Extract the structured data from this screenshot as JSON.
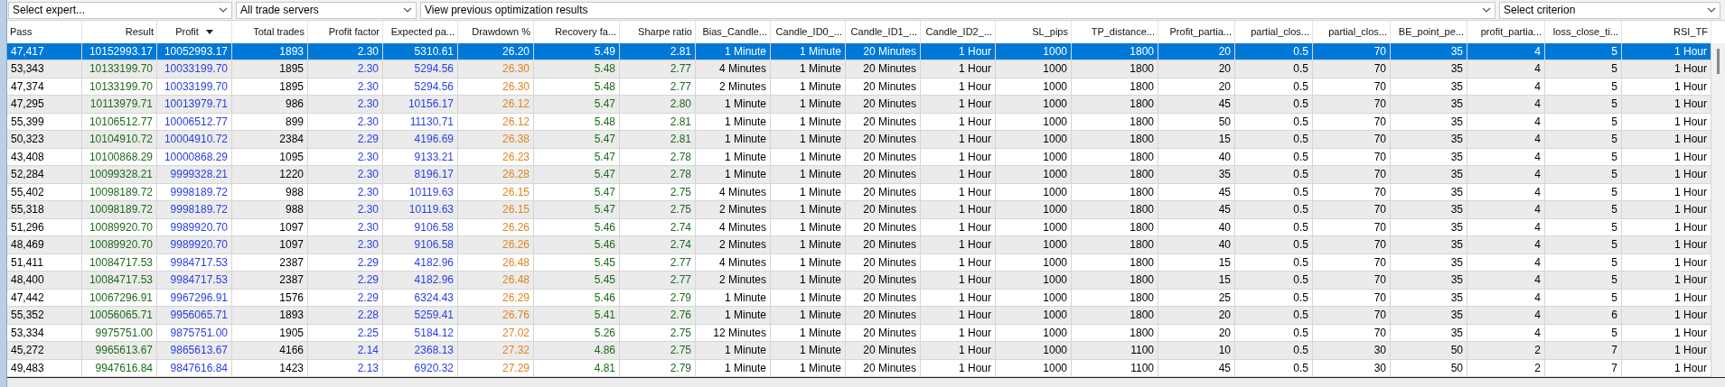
{
  "filters": [
    {
      "value": "Select expert..."
    },
    {
      "value": "All trade servers"
    },
    {
      "value": "View previous optimization results"
    },
    {
      "value": "Select criterion"
    }
  ],
  "table": {
    "columns": [
      {
        "label": "Pass",
        "color": "#000000",
        "sorted": false
      },
      {
        "label": "Result",
        "color": "#1b6b1b",
        "sorted": false
      },
      {
        "label": "Profit",
        "color": "#2a3fe0",
        "sorted": true
      },
      {
        "label": "Total trades",
        "color": "#000000",
        "sorted": false
      },
      {
        "label": "Profit factor",
        "color": "#2a3fe0",
        "sorted": false
      },
      {
        "label": "Expected pa...",
        "color": "#2a3fe0",
        "sorted": false
      },
      {
        "label": "Drawdown %",
        "color": "#e0841c",
        "sorted": false
      },
      {
        "label": "Recovery fa...",
        "color": "#1b6b1b",
        "sorted": false
      },
      {
        "label": "Sharpe ratio",
        "color": "#1b6b1b",
        "sorted": false
      },
      {
        "label": "Bias_Candle...",
        "color": "#000000",
        "sorted": false
      },
      {
        "label": "Candle_ID0_...",
        "color": "#000000",
        "sorted": false
      },
      {
        "label": "Candle_ID1_...",
        "color": "#000000",
        "sorted": false
      },
      {
        "label": "Candle_ID2_...",
        "color": "#000000",
        "sorted": false
      },
      {
        "label": "SL_pips",
        "color": "#000000",
        "sorted": false
      },
      {
        "label": "TP_distance...",
        "color": "#000000",
        "sorted": false
      },
      {
        "label": "Profit_partia...",
        "color": "#000000",
        "sorted": false
      },
      {
        "label": "partial_clos...",
        "color": "#000000",
        "sorted": false
      },
      {
        "label": "partial_clos...",
        "color": "#000000",
        "sorted": false
      },
      {
        "label": "BE_point_pe...",
        "color": "#000000",
        "sorted": false
      },
      {
        "label": "profit_partia...",
        "color": "#000000",
        "sorted": false
      },
      {
        "label": "loss_close_ti...",
        "color": "#000000",
        "sorted": false
      },
      {
        "label": "RSI_TF",
        "color": "#000000",
        "sorted": false
      }
    ],
    "rows": [
      {
        "selected": true,
        "cells": [
          "47,417",
          "10152993.17",
          "10052993.17",
          "1893",
          "2.30",
          "5310.61",
          "26.20",
          "5.49",
          "2.81",
          "1 Minute",
          "1 Minute",
          "20 Minutes",
          "1 Hour",
          "1000",
          "1800",
          "20",
          "0.5",
          "70",
          "35",
          "4",
          "5",
          "1 Hour"
        ]
      },
      {
        "selected": false,
        "cells": [
          "53,343",
          "10133199.70",
          "10033199.70",
          "1895",
          "2.30",
          "5294.56",
          "26.30",
          "5.48",
          "2.77",
          "4 Minutes",
          "1 Minute",
          "20 Minutes",
          "1 Hour",
          "1000",
          "1800",
          "20",
          "0.5",
          "70",
          "35",
          "4",
          "5",
          "1 Hour"
        ]
      },
      {
        "selected": false,
        "cells": [
          "47,374",
          "10133199.70",
          "10033199.70",
          "1895",
          "2.30",
          "5294.56",
          "26.30",
          "5.48",
          "2.77",
          "2 Minutes",
          "1 Minute",
          "20 Minutes",
          "1 Hour",
          "1000",
          "1800",
          "20",
          "0.5",
          "70",
          "35",
          "4",
          "5",
          "1 Hour"
        ]
      },
      {
        "selected": false,
        "cells": [
          "47,295",
          "10113979.71",
          "10013979.71",
          "986",
          "2.30",
          "10156.17",
          "26.12",
          "5.47",
          "2.80",
          "1 Minute",
          "1 Minute",
          "20 Minutes",
          "1 Hour",
          "1000",
          "1800",
          "45",
          "0.5",
          "70",
          "35",
          "4",
          "5",
          "1 Hour"
        ]
      },
      {
        "selected": false,
        "cells": [
          "55,399",
          "10106512.77",
          "10006512.77",
          "899",
          "2.30",
          "11130.71",
          "26.12",
          "5.48",
          "2.81",
          "1 Minute",
          "1 Minute",
          "20 Minutes",
          "1 Hour",
          "1000",
          "1800",
          "50",
          "0.5",
          "70",
          "35",
          "4",
          "5",
          "1 Hour"
        ]
      },
      {
        "selected": false,
        "cells": [
          "50,323",
          "10104910.72",
          "10004910.72",
          "2384",
          "2.29",
          "4196.69",
          "26.38",
          "5.47",
          "2.81",
          "1 Minute",
          "1 Minute",
          "20 Minutes",
          "1 Hour",
          "1000",
          "1800",
          "15",
          "0.5",
          "70",
          "35",
          "4",
          "5",
          "1 Hour"
        ]
      },
      {
        "selected": false,
        "cells": [
          "43,408",
          "10100868.29",
          "10000868.29",
          "1095",
          "2.30",
          "9133.21",
          "26.23",
          "5.47",
          "2.78",
          "1 Minute",
          "1 Minute",
          "20 Minutes",
          "1 Hour",
          "1000",
          "1800",
          "40",
          "0.5",
          "70",
          "35",
          "4",
          "5",
          "1 Hour"
        ]
      },
      {
        "selected": false,
        "cells": [
          "52,284",
          "10099328.21",
          "9999328.21",
          "1220",
          "2.30",
          "8196.17",
          "26.28",
          "5.47",
          "2.78",
          "1 Minute",
          "1 Minute",
          "20 Minutes",
          "1 Hour",
          "1000",
          "1800",
          "35",
          "0.5",
          "70",
          "35",
          "4",
          "5",
          "1 Hour"
        ]
      },
      {
        "selected": false,
        "cells": [
          "55,402",
          "10098189.72",
          "9998189.72",
          "988",
          "2.30",
          "10119.63",
          "26.15",
          "5.47",
          "2.75",
          "4 Minutes",
          "1 Minute",
          "20 Minutes",
          "1 Hour",
          "1000",
          "1800",
          "45",
          "0.5",
          "70",
          "35",
          "4",
          "5",
          "1 Hour"
        ]
      },
      {
        "selected": false,
        "cells": [
          "55,318",
          "10098189.72",
          "9998189.72",
          "988",
          "2.30",
          "10119.63",
          "26.15",
          "5.47",
          "2.75",
          "2 Minutes",
          "1 Minute",
          "20 Minutes",
          "1 Hour",
          "1000",
          "1800",
          "45",
          "0.5",
          "70",
          "35",
          "4",
          "5",
          "1 Hour"
        ]
      },
      {
        "selected": false,
        "cells": [
          "51,296",
          "10089920.70",
          "9989920.70",
          "1097",
          "2.30",
          "9106.58",
          "26.26",
          "5.46",
          "2.74",
          "4 Minutes",
          "1 Minute",
          "20 Minutes",
          "1 Hour",
          "1000",
          "1800",
          "40",
          "0.5",
          "70",
          "35",
          "4",
          "5",
          "1 Hour"
        ]
      },
      {
        "selected": false,
        "cells": [
          "48,469",
          "10089920.70",
          "9989920.70",
          "1097",
          "2.30",
          "9106.58",
          "26.26",
          "5.46",
          "2.74",
          "2 Minutes",
          "1 Minute",
          "20 Minutes",
          "1 Hour",
          "1000",
          "1800",
          "40",
          "0.5",
          "70",
          "35",
          "4",
          "5",
          "1 Hour"
        ]
      },
      {
        "selected": false,
        "cells": [
          "51,411",
          "10084717.53",
          "9984717.53",
          "2387",
          "2.29",
          "4182.96",
          "26.48",
          "5.45",
          "2.77",
          "4 Minutes",
          "1 Minute",
          "20 Minutes",
          "1 Hour",
          "1000",
          "1800",
          "15",
          "0.5",
          "70",
          "35",
          "4",
          "5",
          "1 Hour"
        ]
      },
      {
        "selected": false,
        "cells": [
          "48,400",
          "10084717.53",
          "9984717.53",
          "2387",
          "2.29",
          "4182.96",
          "26.48",
          "5.45",
          "2.77",
          "2 Minutes",
          "1 Minute",
          "20 Minutes",
          "1 Hour",
          "1000",
          "1800",
          "15",
          "0.5",
          "70",
          "35",
          "4",
          "5",
          "1 Hour"
        ]
      },
      {
        "selected": false,
        "cells": [
          "47,442",
          "10067296.91",
          "9967296.91",
          "1576",
          "2.29",
          "6324.43",
          "26.29",
          "5.46",
          "2.79",
          "1 Minute",
          "1 Minute",
          "20 Minutes",
          "1 Hour",
          "1000",
          "1800",
          "25",
          "0.5",
          "70",
          "35",
          "4",
          "5",
          "1 Hour"
        ]
      },
      {
        "selected": false,
        "cells": [
          "55,352",
          "10056065.71",
          "9956065.71",
          "1893",
          "2.28",
          "5259.41",
          "26.76",
          "5.41",
          "2.76",
          "1 Minute",
          "1 Minute",
          "20 Minutes",
          "1 Hour",
          "1000",
          "1800",
          "20",
          "0.5",
          "70",
          "35",
          "4",
          "6",
          "1 Hour"
        ]
      },
      {
        "selected": false,
        "cells": [
          "53,334",
          "9975751.00",
          "9875751.00",
          "1905",
          "2.25",
          "5184.12",
          "27.02",
          "5.26",
          "2.75",
          "12 Minutes",
          "1 Minute",
          "20 Minutes",
          "1 Hour",
          "1000",
          "1800",
          "20",
          "0.5",
          "70",
          "35",
          "4",
          "5",
          "1 Hour"
        ]
      },
      {
        "selected": false,
        "cells": [
          "45,272",
          "9965613.67",
          "9865613.67",
          "4166",
          "2.14",
          "2368.13",
          "27.32",
          "4.86",
          "2.75",
          "1 Minute",
          "1 Minute",
          "20 Minutes",
          "1 Hour",
          "1000",
          "1100",
          "10",
          "0.5",
          "30",
          "50",
          "2",
          "7",
          "1 Hour"
        ]
      },
      {
        "selected": false,
        "cells": [
          "49,483",
          "9947616.84",
          "9847616.84",
          "1423",
          "2.13",
          "6920.32",
          "27.29",
          "4.81",
          "2.79",
          "1 Minute",
          "1 Minute",
          "20 Minutes",
          "1 Hour",
          "1000",
          "1100",
          "45",
          "0.5",
          "30",
          "50",
          "2",
          "7",
          "1 Hour"
        ]
      }
    ]
  }
}
